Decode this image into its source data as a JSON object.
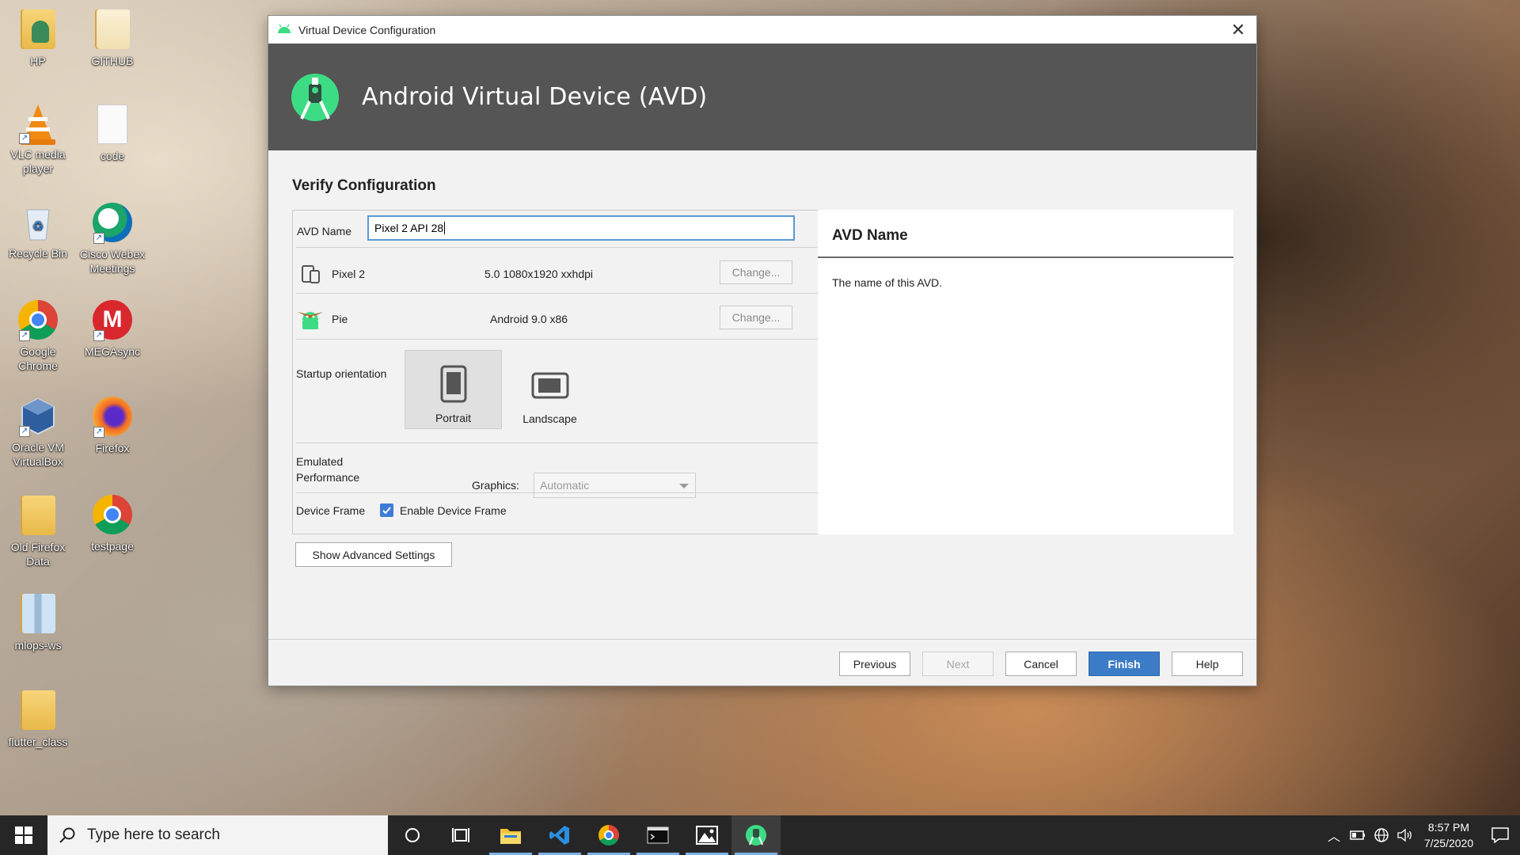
{
  "desktop": {
    "icons": [
      {
        "label": "HP",
        "icon": "user-folder-icon"
      },
      {
        "label": "GITHUB",
        "icon": "folder-icon"
      },
      {
        "label": "VLC media player",
        "icon": "vlc-icon"
      },
      {
        "label": "code",
        "icon": "file-icon"
      },
      {
        "label": "Recycle Bin",
        "icon": "recycle-bin-icon"
      },
      {
        "label": "Cisco Webex Meetings",
        "icon": "webex-icon"
      },
      {
        "label": "Google Chrome",
        "icon": "chrome-icon"
      },
      {
        "label": "MEGAsync",
        "icon": "megasync-icon"
      },
      {
        "label": "Oracle VM VirtualBox",
        "icon": "virtualbox-icon"
      },
      {
        "label": "Firefox",
        "icon": "firefox-icon"
      },
      {
        "label": "Old Firefox Data",
        "icon": "folder-icon"
      },
      {
        "label": "testpage",
        "icon": "chrome-icon"
      },
      {
        "label": "mlops-ws",
        "icon": "zip-folder-icon"
      },
      {
        "label": "flutter_class",
        "icon": "folder-icon"
      }
    ]
  },
  "dialog": {
    "window_title": "Virtual Device Configuration",
    "banner_title": "Android Virtual Device (AVD)",
    "section_title": "Verify Configuration",
    "avd_name_label": "AVD Name",
    "avd_name_value": "Pixel 2 API 28",
    "device": {
      "name": "Pixel 2",
      "spec": "5.0 1080x1920 xxhdpi",
      "change_label": "Change..."
    },
    "system_image": {
      "name": "Pie",
      "spec": "Android 9.0 x86",
      "change_label": "Change..."
    },
    "startup_orientation_label": "Startup orientation",
    "orientation_options": [
      {
        "label": "Portrait",
        "selected": true
      },
      {
        "label": "Landscape",
        "selected": false
      }
    ],
    "emulated_performance_label": "Emulated\nPerformance",
    "graphics_label": "Graphics:",
    "graphics_value": "Automatic",
    "device_frame_label": "Device Frame",
    "enable_device_frame_label": "Enable Device Frame",
    "enable_device_frame_checked": true,
    "show_advanced_label": "Show Advanced Settings",
    "info": {
      "title": "AVD Name",
      "text": "The name of this AVD."
    },
    "buttons": {
      "previous": "Previous",
      "next": "Next",
      "cancel": "Cancel",
      "finish": "Finish",
      "help": "Help"
    },
    "accent_color": "#3c7bc6"
  },
  "taskbar": {
    "search_placeholder": "Type here to search",
    "time": "8:57 PM",
    "date": "7/25/2020"
  }
}
